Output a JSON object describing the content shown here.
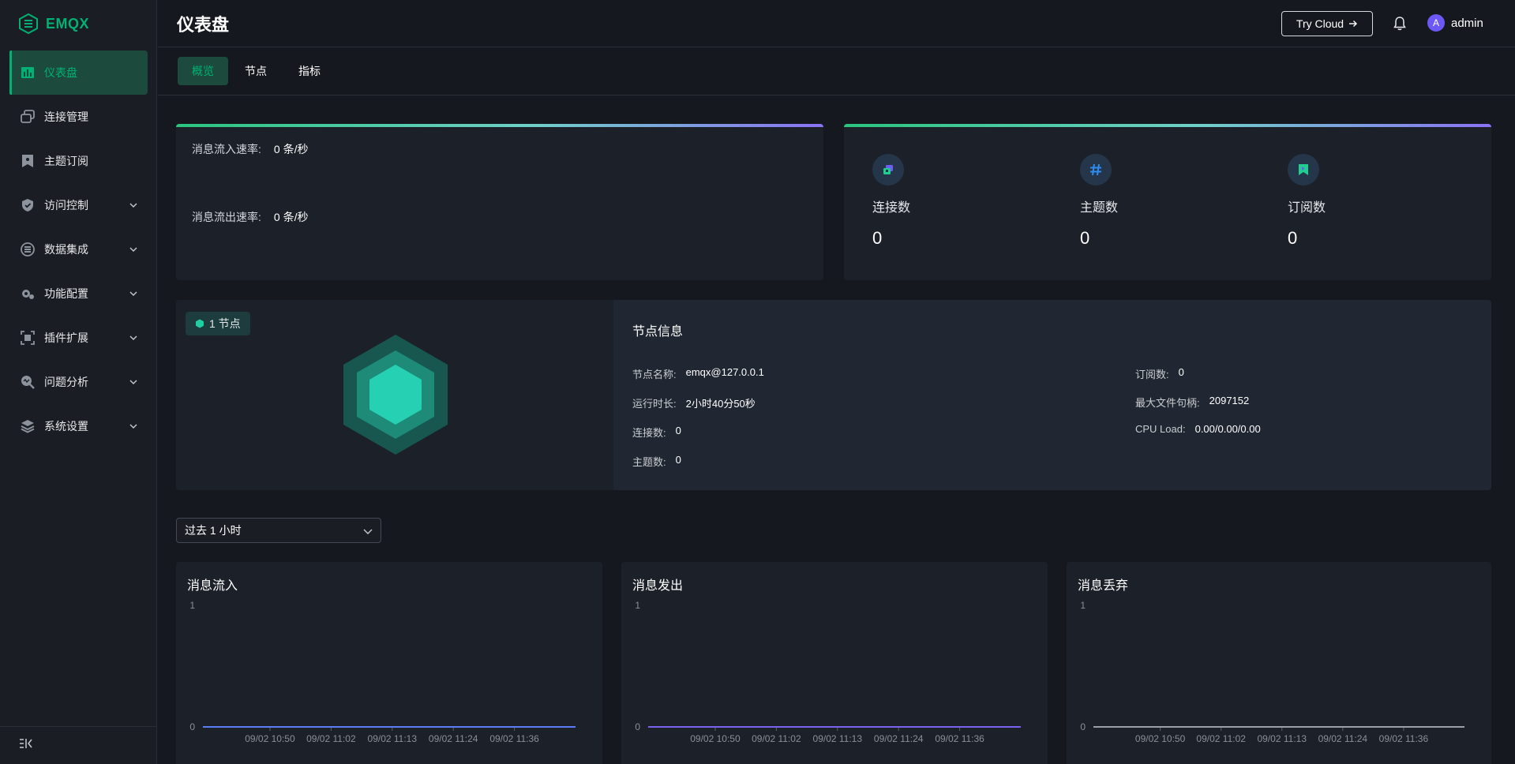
{
  "app": {
    "logo_text": "EMQX",
    "page_title": "仪表盘",
    "try_cloud_label": "Try Cloud",
    "user_initial": "A",
    "user_name": "admin"
  },
  "sidebar": {
    "items": [
      {
        "label": "仪表盘",
        "icon": "dashboard-icon",
        "active": true
      },
      {
        "label": "连接管理",
        "icon": "connections-icon"
      },
      {
        "label": "主题订阅",
        "icon": "subscriptions-icon"
      },
      {
        "label": "访问控制",
        "icon": "access-control-icon",
        "expandable": true
      },
      {
        "label": "数据集成",
        "icon": "data-integration-icon",
        "expandable": true
      },
      {
        "label": "功能配置",
        "icon": "settings-gear-icon",
        "expandable": true
      },
      {
        "label": "插件扩展",
        "icon": "plugins-icon",
        "expandable": true
      },
      {
        "label": "问题分析",
        "icon": "diagnose-icon",
        "expandable": true
      },
      {
        "label": "系统设置",
        "icon": "system-icon",
        "expandable": true
      }
    ]
  },
  "tabs": [
    {
      "label": "概览",
      "active": true
    },
    {
      "label": "节点"
    },
    {
      "label": "指标"
    }
  ],
  "rates": {
    "in_label": "消息流入速率:",
    "in_value": "0 条/秒",
    "out_label": "消息流出速率:",
    "out_value": "0 条/秒"
  },
  "stats": [
    {
      "label": "连接数",
      "value": "0",
      "icon": "connection-icon"
    },
    {
      "label": "主题数",
      "value": "0",
      "icon": "hash-icon"
    },
    {
      "label": "订阅数",
      "value": "0",
      "icon": "flag-icon"
    }
  ],
  "node": {
    "badge": "1 节点",
    "info_title": "节点信息",
    "left_fields": [
      {
        "k": "节点名称:",
        "v": "emqx@127.0.0.1"
      },
      {
        "k": "运行时长:",
        "v": "2小时40分50秒"
      },
      {
        "k": "连接数:",
        "v": "0"
      },
      {
        "k": "主题数:",
        "v": "0"
      }
    ],
    "right_fields": [
      {
        "k": "订阅数:",
        "v": "0"
      },
      {
        "k": "最大文件句柄:",
        "v": "2097152"
      },
      {
        "k": "CPU Load:",
        "v": "0.00/0.00/0.00"
      }
    ]
  },
  "time_range": {
    "selected": "过去 1 小时"
  },
  "colors": {
    "accent": "#00b173",
    "line_in": "#5b7cf7",
    "line_out": "#7b61f0",
    "line_drop": "#9aa0a8"
  },
  "chart_data": [
    {
      "type": "line",
      "title": "消息流入",
      "x": [
        "09/02 10:50",
        "09/02 11:02",
        "09/02 11:13",
        "09/02 11:24",
        "09/02 11:36"
      ],
      "series": [
        {
          "values": [
            0,
            0,
            0,
            0,
            0
          ]
        }
      ],
      "ylim": [
        0,
        1
      ],
      "yticks": [
        "0",
        "1"
      ]
    },
    {
      "type": "line",
      "title": "消息发出",
      "x": [
        "09/02 10:50",
        "09/02 11:02",
        "09/02 11:13",
        "09/02 11:24",
        "09/02 11:36"
      ],
      "series": [
        {
          "values": [
            0,
            0,
            0,
            0,
            0
          ]
        }
      ],
      "ylim": [
        0,
        1
      ],
      "yticks": [
        "0",
        "1"
      ]
    },
    {
      "type": "line",
      "title": "消息丢弃",
      "x": [
        "09/02 10:50",
        "09/02 11:02",
        "09/02 11:13",
        "09/02 11:24",
        "09/02 11:36"
      ],
      "series": [
        {
          "values": [
            0,
            0,
            0,
            0,
            0
          ]
        }
      ],
      "ylim": [
        0,
        1
      ],
      "yticks": [
        "0",
        "1"
      ]
    }
  ]
}
